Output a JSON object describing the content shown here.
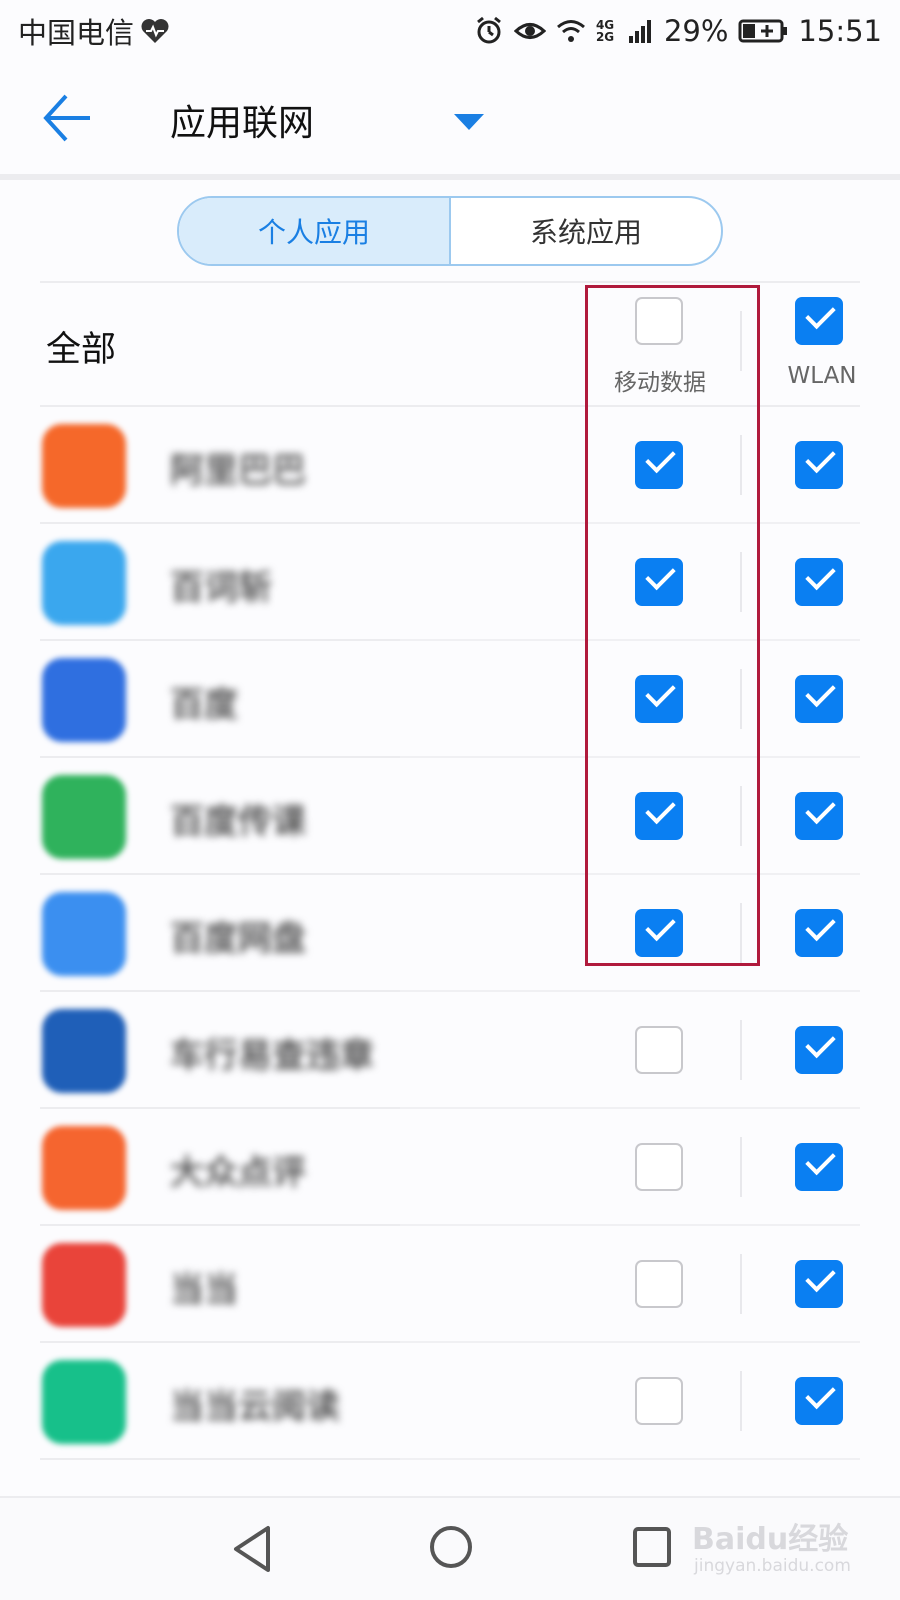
{
  "status_bar": {
    "carrier": "中国电信",
    "network": "4G 2G",
    "battery": "29%",
    "time": "15:51"
  },
  "header": {
    "title": "应用联网"
  },
  "tabs": [
    {
      "label": "个人应用",
      "active": true
    },
    {
      "label": "系统应用",
      "active": false
    }
  ],
  "all_row": {
    "label": "全部",
    "mobile_label": "移动数据",
    "wlan_label": "WLAN",
    "mobile_checked": false,
    "wlan_checked": true
  },
  "apps": [
    {
      "name": "阿里巴巴",
      "icon_color": "#f5682a",
      "mobile": true,
      "wlan": true
    },
    {
      "name": "百词斩",
      "icon_color": "#3aa7ee",
      "mobile": true,
      "wlan": true
    },
    {
      "name": "百度",
      "icon_color": "#2f6fe0",
      "mobile": true,
      "wlan": true
    },
    {
      "name": "百度传课",
      "icon_color": "#2fb25c",
      "mobile": true,
      "wlan": true
    },
    {
      "name": "百度网盘",
      "icon_color": "#3b8ff0",
      "mobile": true,
      "wlan": true
    },
    {
      "name": "车行易查违章",
      "icon_color": "#1f5fb8",
      "mobile": false,
      "wlan": true
    },
    {
      "name": "大众点评",
      "icon_color": "#f5652f",
      "mobile": false,
      "wlan": true
    },
    {
      "name": "当当",
      "icon_color": "#e9443a",
      "mobile": false,
      "wlan": true
    },
    {
      "name": "当当云阅读",
      "icon_color": "#17c08a",
      "mobile": false,
      "wlan": true
    }
  ],
  "watermark": {
    "main": "Baidu经验",
    "sub": "jingyan.baidu.com"
  },
  "colors": {
    "accent": "#0a7ff2",
    "highlight": "#b01a3c"
  }
}
